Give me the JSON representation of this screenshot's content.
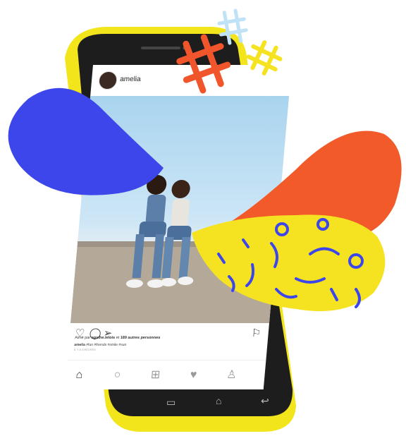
{
  "post": {
    "username": "amelia",
    "likes_prefix": "Aimé par ",
    "likes_user": "agathe.lelois",
    "likes_suffix": " et ",
    "likes_count": "189 autres personnes",
    "caption_user": "amelia",
    "caption_text": " #fun #friends #smile #sun",
    "time": "IL Y A 4 HEURES"
  },
  "icons": {
    "heart": "heart-icon",
    "comment": "comment-icon",
    "share": "paper-plane-icon",
    "bookmark": "bookmark-icon",
    "home": "home-icon",
    "search": "search-icon",
    "add": "add-post-icon",
    "activity": "heart-icon",
    "profile": "profile-icon",
    "recent": "recent-apps-icon",
    "android_home": "android-home-icon",
    "back": "back-icon"
  },
  "colors": {
    "phone_yellow": "#f2e51b",
    "phone_black": "#1d1d1d",
    "blue_blob": "#3c46ea",
    "orange_blob": "#f25a2a",
    "yellow_blob": "#f5e322",
    "hashtag_red": "#f0552b",
    "hashtag_yellow": "#f5e322",
    "hashtag_lightblue": "#bfe2f7"
  }
}
